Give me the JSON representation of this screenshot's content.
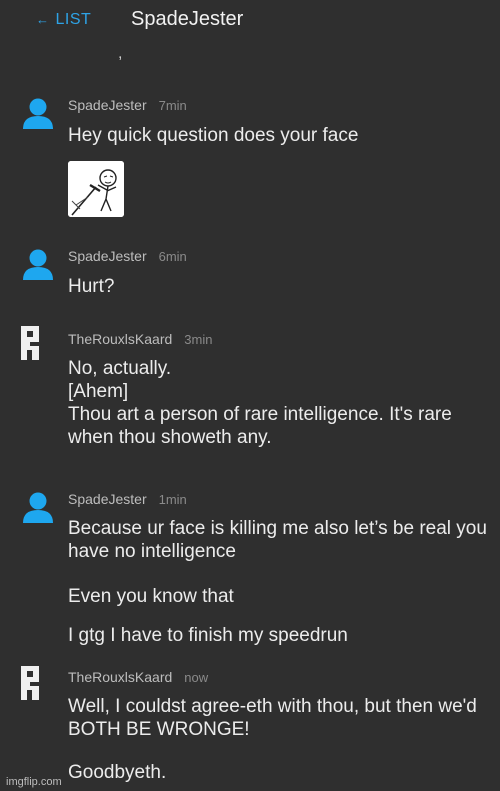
{
  "header": {
    "back_label": "LIST",
    "title": "SpadeJester"
  },
  "messages": [
    {
      "author": "SpadeJester",
      "time": "7min",
      "text1": "Hey quick question does your face",
      "has_image": true
    },
    {
      "author": "SpadeJester",
      "time": "6min",
      "text1": "Hurt?"
    },
    {
      "author": "TheRouxlsKaard",
      "time": "3min",
      "text1": "No, actually.\n[Ahem]\nThou art a person of rare intelligence. It's rare when thou showeth any."
    },
    {
      "author": "SpadeJester",
      "time": "1min",
      "text1": "Because ur face is killing me also let’s be real you have no intelligence",
      "text2": "Even you know that",
      "text3": "I gtg I have to finish my speedrun"
    },
    {
      "author": "TheRouxlsKaard",
      "time": "now",
      "text1": "Well, I couldst agree-eth with thou, but then we'd BOTH BE WRONGE!",
      "text2": "Goodbyeth."
    }
  ],
  "watermark": "imgflip.com",
  "colors": {
    "background": "#2f2f2f",
    "accent": "#2ea3e6",
    "user_avatar": "#1ea7ef",
    "kaard_avatar": "#f0f0f0"
  },
  "icons": {
    "user_avatar": "person-icon",
    "kaard_avatar": "rouxls-kaard-icon",
    "back": "left-arrow-icon"
  }
}
